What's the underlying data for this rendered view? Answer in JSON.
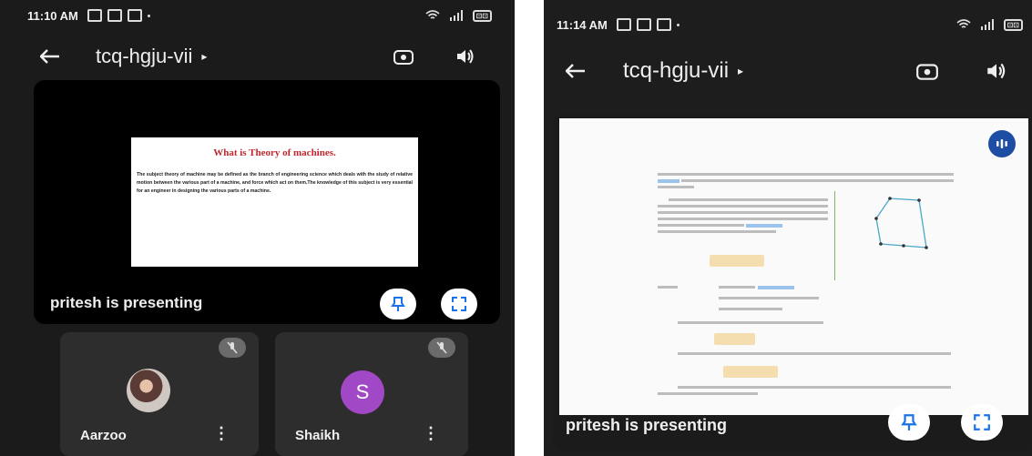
{
  "left": {
    "status": {
      "time": "11:10 AM",
      "battery": "⊡⊡"
    },
    "topbar": {
      "back_icon": "arrow-back-icon",
      "title": "tcq-hgju-vii",
      "caret": "▸"
    },
    "slide": {
      "title": "What is Theory of machines.",
      "body": "The subject theory of machine may be defined as the branch of engineering science which deals with the study of relative motion between the various part of a machine, and force which act on them.The knowledge of this subject is very essential for an engineer in designing the various parts of a machine."
    },
    "presenting": "pritesh is presenting",
    "participants": [
      {
        "name": "Aarzoo",
        "avatar": "photo",
        "menu": "⋮"
      },
      {
        "name": "Shaikh",
        "avatar_letter": "S",
        "menu": "⋮"
      }
    ]
  },
  "right": {
    "status": {
      "time": "11:14 AM",
      "battery": "⊡⊡"
    },
    "topbar": {
      "title": "tcq-hgju-vii",
      "caret": "▸"
    },
    "presenting": "pritesh is presenting"
  },
  "colors": {
    "slide_title": "#c0282e",
    "avatar_purple": "#a148c6",
    "badge_blue": "#1e4ea3",
    "highlight": "#9cc3ec"
  }
}
